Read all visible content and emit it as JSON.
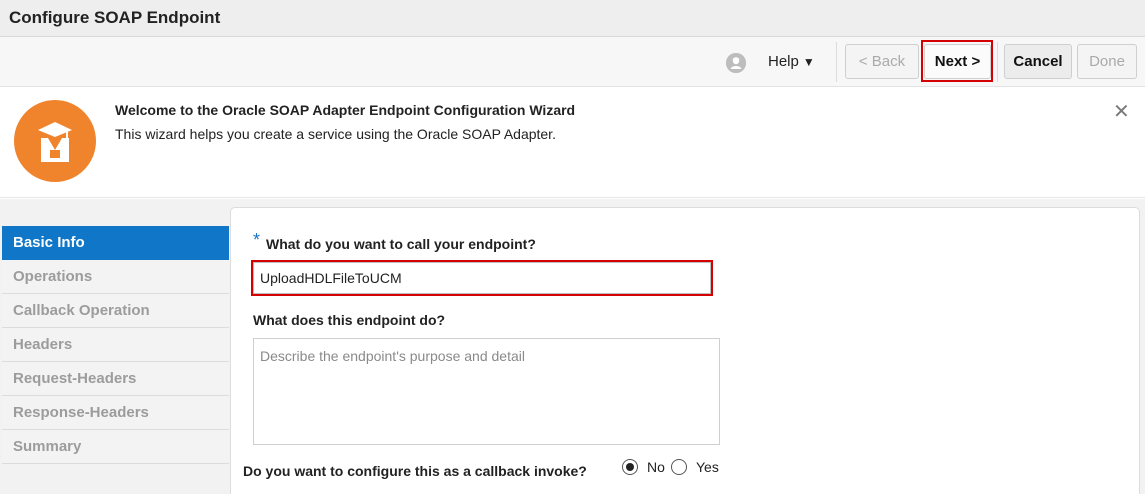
{
  "window": {
    "title": "Configure SOAP Endpoint"
  },
  "toolbar": {
    "user_icon": "user-icon",
    "help_label": "Help",
    "help_caret": "▼",
    "back_label": "<  Back",
    "next_label": "Next  >",
    "cancel_label": "Cancel",
    "done_label": "Done"
  },
  "welcome": {
    "icon": "graduate-icon",
    "title": "Welcome to the Oracle SOAP Adapter Endpoint Configuration Wizard",
    "subtitle": "This wizard helps you create a service using the Oracle SOAP Adapter.",
    "close_glyph": "✕"
  },
  "nav": {
    "items": [
      {
        "label": "Basic Info",
        "active": true
      },
      {
        "label": "Operations",
        "active": false
      },
      {
        "label": "Callback Operation",
        "active": false
      },
      {
        "label": "Headers",
        "active": false
      },
      {
        "label": "Request-Headers",
        "active": false
      },
      {
        "label": "Response-Headers",
        "active": false
      },
      {
        "label": "Summary",
        "active": false
      }
    ]
  },
  "form": {
    "required_marker": "*",
    "name_label": "What do you want to call your endpoint?",
    "name_value": "UploadHDLFileToUCM",
    "desc_label": "What does this endpoint do?",
    "desc_placeholder": "Describe the endpoint's purpose and detail",
    "callback_label": "Do you want to configure this as a callback invoke?",
    "callback_options": [
      {
        "label": "No",
        "selected": true
      },
      {
        "label": "Yes",
        "selected": false
      }
    ]
  },
  "colors": {
    "accent": "#1077c8",
    "brand_orange": "#f0842c",
    "highlight_red": "#d50000"
  }
}
